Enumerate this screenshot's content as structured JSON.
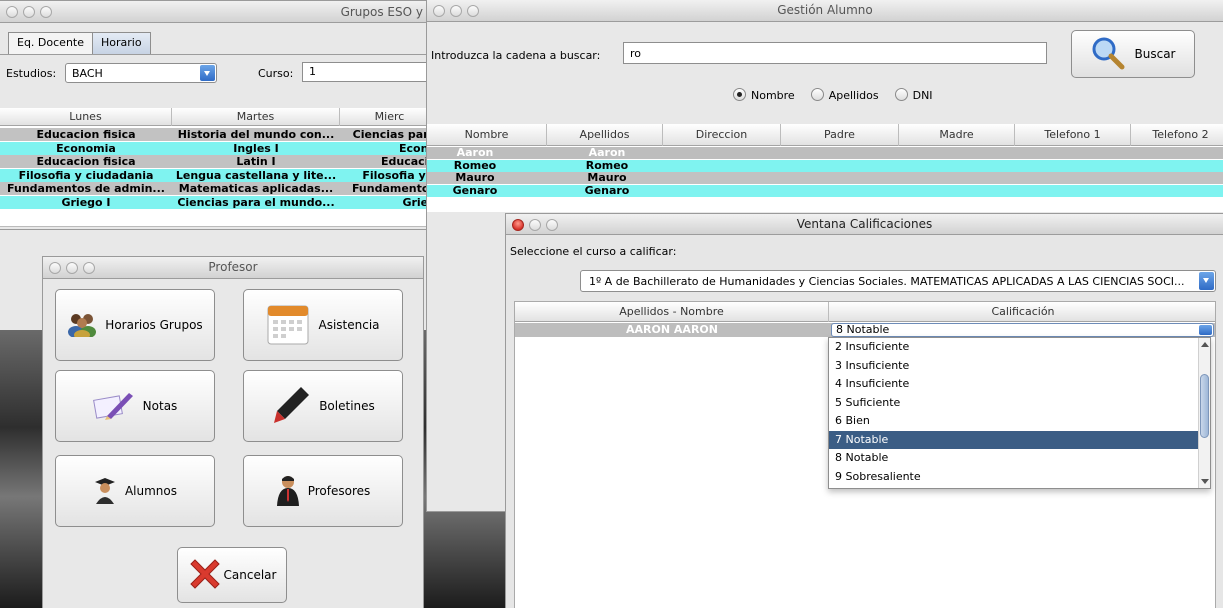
{
  "grupos_window": {
    "title": "Grupos ESO y",
    "tabs": [
      "Eq. Docente",
      "Horario"
    ],
    "estudios_label": "Estudios:",
    "estudios_value": "BACH",
    "curso_label": "Curso:",
    "curso_value": "1",
    "columns": [
      "Lunes",
      "Martes",
      "Mierc"
    ],
    "rows": [
      [
        "Educacion fisica",
        "Historia del mundo con...",
        "Ciencias para"
      ],
      [
        "Economia",
        "Ingles I",
        "Econo"
      ],
      [
        "Educacion fisica",
        "Latin I",
        "Educacio"
      ],
      [
        "Filosofia y ciudadania",
        "Lengua castellana y lite...",
        "Filosofia y c"
      ],
      [
        "Fundamentos de admin...",
        "Matematicas aplicadas...",
        "Fundamentos"
      ],
      [
        "Griego I",
        "Ciencias para el mundo...",
        "Grieg"
      ]
    ]
  },
  "profesor_window": {
    "title": "Profesor",
    "buttons": {
      "horarios": "Horarios Grupos",
      "asistencia": "Asistencia",
      "notas": "Notas",
      "boletines": "Boletines",
      "alumnos": "Alumnos",
      "profesores": "Profesores",
      "cancelar": "Cancelar"
    }
  },
  "gestion_window": {
    "title": "Gestión Alumno",
    "search_label": "Introduzca la cadena a buscar:",
    "search_value": "ro",
    "buscar_label": "Buscar",
    "radios": [
      "Nombre",
      "Apellidos",
      "DNI"
    ],
    "selected_radio": "Nombre",
    "columns": [
      "Nombre",
      "Apellidos",
      "Direccion",
      "Padre",
      "Madre",
      "Telefono 1",
      "Telefono 2"
    ],
    "rows": [
      [
        "Aaron",
        "Aaron"
      ],
      [
        "Romeo",
        "Romeo"
      ],
      [
        "Mauro",
        "Mauro"
      ],
      [
        "Genaro",
        "Genaro"
      ]
    ]
  },
  "calificaciones_window": {
    "title": "Ventana Calificaciones",
    "prompt": "Seleccione el curso a calificar:",
    "curso_value": "1º A de Bachillerato de Humanidades y Ciencias Sociales. MATEMATICAS APLICADAS A LAS CIENCIAS SOCI...",
    "columns": [
      "Apellidos - Nombre",
      "Calificación"
    ],
    "student": "AARON AARON",
    "current_grade": "8 Notable",
    "options": [
      "2 Insuficiente",
      "3 Insuficiente",
      "4 Insuficiente",
      "5 Suficiente",
      "6 Bien",
      "7 Notable",
      "8 Notable",
      "9 Sobresaliente"
    ],
    "highlighted_option": "7 Notable"
  },
  "colors": {
    "cyan_row": "#7ff3f0",
    "gray_row": "#c2c2c2",
    "selected_row": "#bdbdbd",
    "dropdown_highlight": "#3b5d85",
    "accent_blue": "#2f6bc6"
  }
}
